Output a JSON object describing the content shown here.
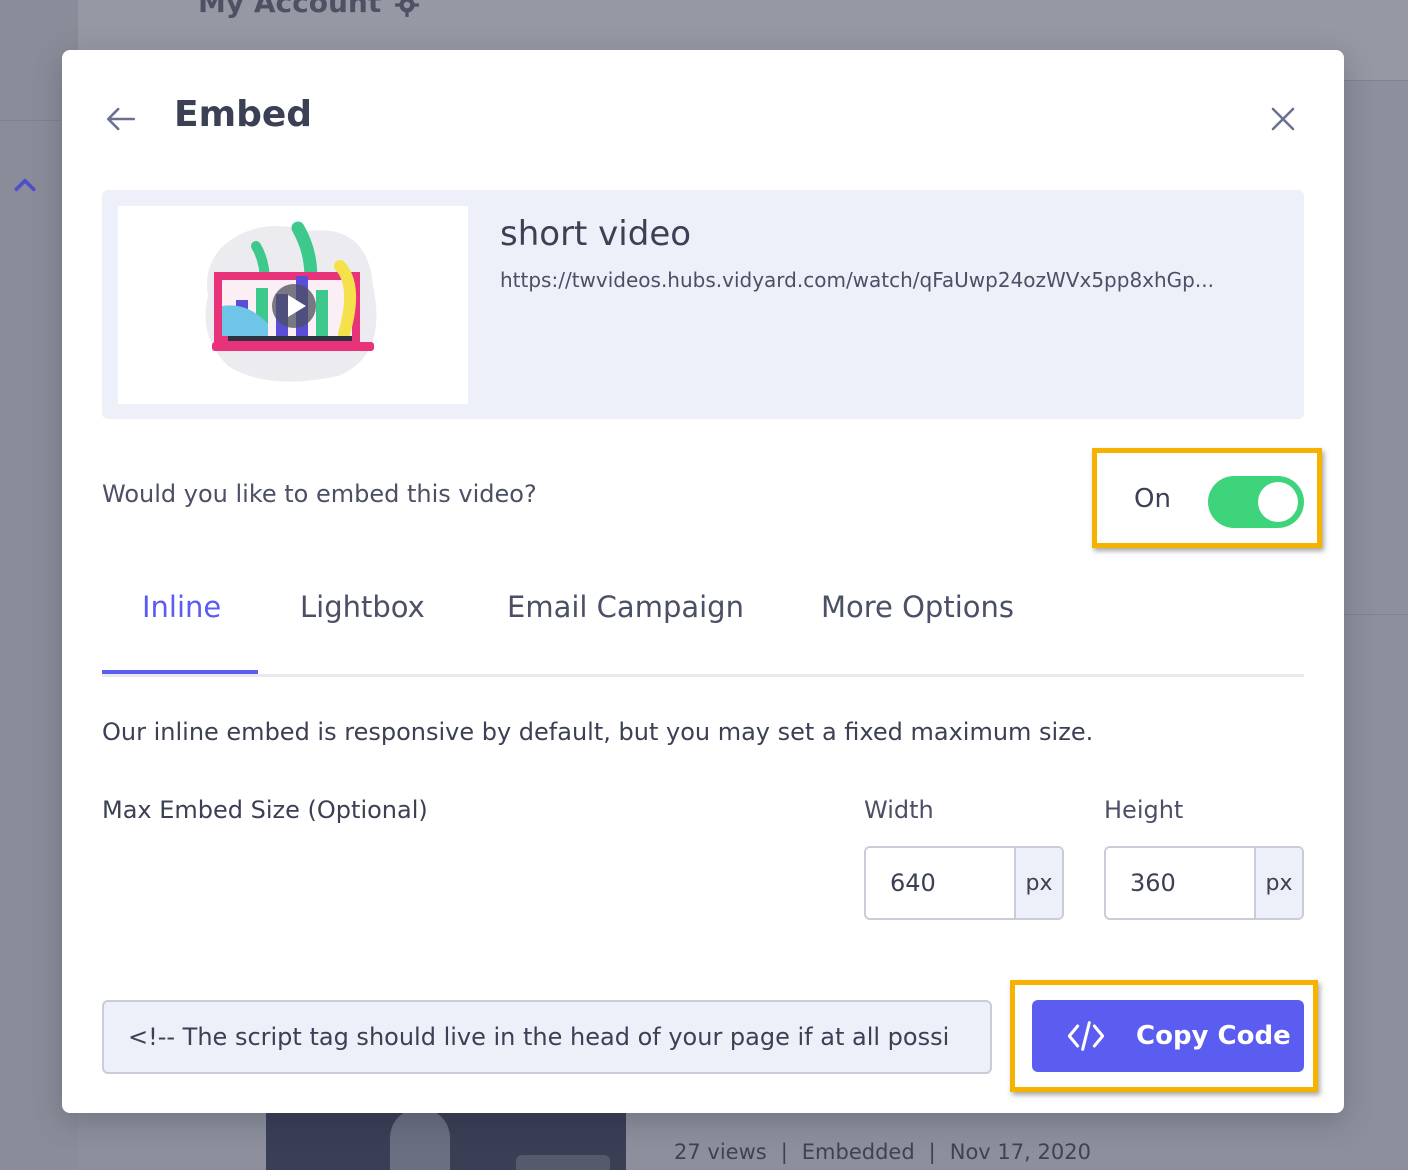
{
  "background": {
    "account_label": "My Account",
    "meta": {
      "views": "27 views",
      "status": "Embedded",
      "date": "Nov 17, 2020",
      "separator": "|"
    }
  },
  "modal": {
    "title": "Embed",
    "video": {
      "title": "short video",
      "url": "https://twvideos.hubs.vidyard.com/watch/qFaUwp24ozWVx5pp8xhGp..."
    },
    "embed_question": "Would you like to embed this video?",
    "toggle": {
      "label": "On",
      "state": "on"
    },
    "tabs": [
      {
        "label": "Inline",
        "active": true
      },
      {
        "label": "Lightbox",
        "active": false
      },
      {
        "label": "Email Campaign",
        "active": false
      },
      {
        "label": "More Options",
        "active": false
      }
    ],
    "inline_description": "Our inline embed is responsive by default, but you may set a fixed maximum size.",
    "max_size_label": "Max Embed Size (Optional)",
    "width": {
      "label": "Width",
      "value": "640",
      "unit": "px"
    },
    "height": {
      "label": "Height",
      "value": "360",
      "unit": "px"
    },
    "code_snippet": "<!-- The script tag should live in the head of your page if at all possi",
    "copy_button_label": "Copy Code"
  },
  "colors": {
    "accent": "#5b5cf0",
    "toggle_on": "#3dd47c",
    "highlight": "#f5b300",
    "card_bg": "#edf0f8",
    "text": "#3b4054"
  }
}
